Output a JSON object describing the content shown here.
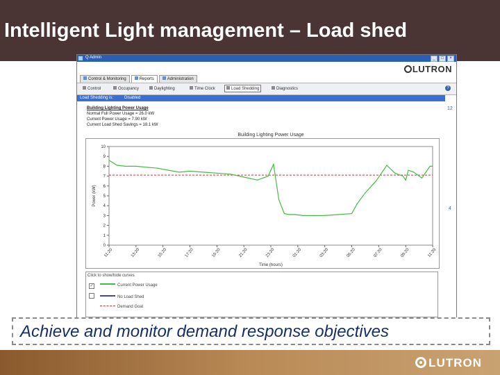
{
  "slide": {
    "title": "Intelligent Light management – Load shed",
    "caption": "Achieve and monitor demand response objectives",
    "footer_logo": "LUTRON"
  },
  "app": {
    "window_title": "Q Admin",
    "logo": "LUTRON",
    "tabs": [
      {
        "label": "Control & Monitoring",
        "active": false
      },
      {
        "label": "Reports",
        "active": true
      },
      {
        "label": "Administration",
        "active": false
      }
    ],
    "toolbar": [
      {
        "label": "Control",
        "active": false
      },
      {
        "label": "Occupancy",
        "active": false
      },
      {
        "label": "Daylighting",
        "active": false
      },
      {
        "label": "Time Clock",
        "active": false
      },
      {
        "label": "Load Shedding",
        "active": true
      },
      {
        "label": "Diagnostics",
        "active": false
      }
    ],
    "status_label": "Load Shedding is:",
    "status_value": "Disabled",
    "side_numbers": [
      "12",
      "4"
    ],
    "summary": {
      "heading": "Building Lighting Power Usage",
      "lines": [
        "Normal Full Power Usage = 26.0 kW",
        "Current Power Usage = 7.90 kW",
        "Current Load Shed Savings = 18.1 kW"
      ]
    },
    "legend": {
      "title": "Click to show/hide curves",
      "items": [
        {
          "label": "Current Power Usage",
          "checked": true,
          "color": "#44bb44",
          "dashed": false
        },
        {
          "label": "No Load Shed",
          "checked": false,
          "color": "#4444aa",
          "dashed": false
        },
        {
          "label": "Demand Goal",
          "checked": false,
          "color": "#cc3333",
          "dashed": true
        }
      ]
    }
  },
  "chart_data": {
    "type": "line",
    "title": "Building Lighting Power Usage",
    "xlabel": "Time (hours)",
    "ylabel": "Power (kW)",
    "ylim": [
      0,
      10
    ],
    "yticks": [
      0,
      1,
      2,
      3,
      4,
      5,
      6,
      7,
      8,
      9,
      10
    ],
    "xticks": [
      "11:20",
      "13:20",
      "15:20",
      "17:20",
      "19:20",
      "21:20",
      "23:20",
      "01:20",
      "03:20",
      "05:20",
      "07:20",
      "09:20",
      "11:20"
    ],
    "xlim": [
      0,
      12
    ],
    "series": [
      {
        "name": "Current Power Usage",
        "color": "#44bb44",
        "x": [
          0,
          0.3,
          0.6,
          1.0,
          1.4,
          1.8,
          2.2,
          2.6,
          3.0,
          3.5,
          4.0,
          4.5,
          5.0,
          5.5,
          5.9,
          6.1,
          6.3,
          6.5,
          6.7,
          6.9,
          7.2,
          7.6,
          8.0,
          8.5,
          9.0,
          9.2,
          9.5,
          9.9,
          10.3,
          10.6,
          10.9,
          11.0,
          11.1,
          11.3,
          11.6,
          11.9,
          12.0
        ],
        "y": [
          8.6,
          8.1,
          8.0,
          8.0,
          7.9,
          7.8,
          7.6,
          7.4,
          7.5,
          7.4,
          7.3,
          7.2,
          6.9,
          6.6,
          7.0,
          8.2,
          4.6,
          3.2,
          3.1,
          3.1,
          3.0,
          3.0,
          3.0,
          3.1,
          3.2,
          4.2,
          5.3,
          6.5,
          8.1,
          7.3,
          7.0,
          6.6,
          7.6,
          7.4,
          6.8,
          8.0,
          8.0
        ]
      }
    ],
    "reference_lines": [
      {
        "name": "Demand Goal",
        "y": 7.1,
        "color": "#cc3333",
        "dashed": true
      }
    ]
  }
}
